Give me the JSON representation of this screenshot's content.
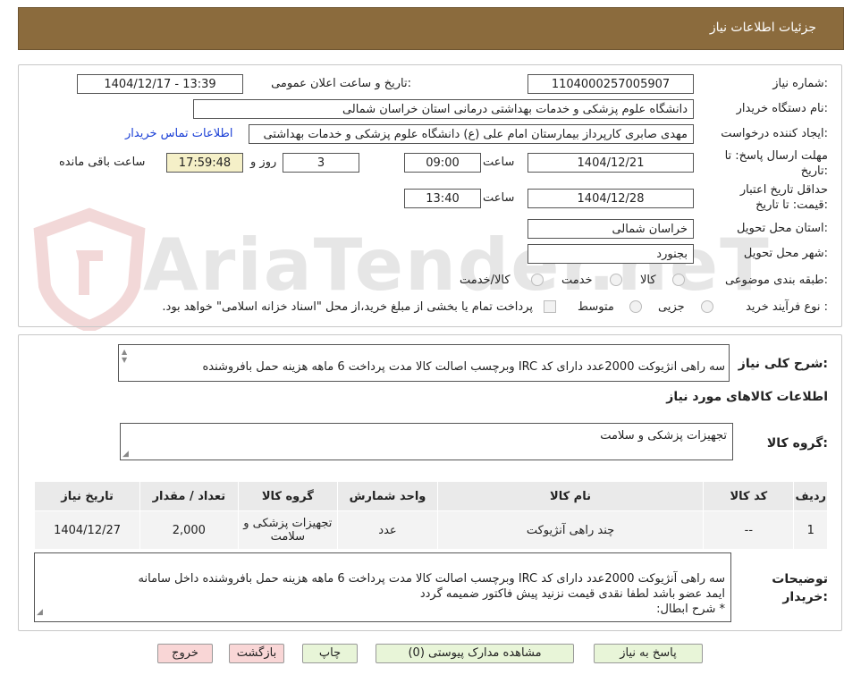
{
  "header": {
    "title": "جزئیات اطلاعات نیاز"
  },
  "watermark": "AriaTender.neT",
  "fields": {
    "need_number_label": "شماره نیاز:",
    "need_number": "1104000257005907",
    "announce_label": "تاریخ و ساعت اعلان عمومی:",
    "announce_value": "1404/12/17 - 13:39",
    "buyer_label": "نام دستگاه خریدار:",
    "buyer_value": "دانشگاه علوم پزشکی و خدمات بهداشتی درمانی استان خراسان شمالی",
    "creator_label": "ایجاد کننده درخواست:",
    "creator_value": "مهدی صابری کارپرداز بیمارستان امام علی (ع) دانشگاه علوم پزشکی و خدمات بهداشتی",
    "contact_link": "اطلاعات تماس خریدار",
    "deadline_label": "مهلت ارسال پاسخ: تا تاریخ:",
    "deadline_date": "1404/12/21",
    "time_label": "ساعت",
    "deadline_time": "09:00",
    "days_value": "3",
    "days_label": "روز و",
    "remaining_time": "17:59:48",
    "remaining_label": "ساعت باقی مانده",
    "validity_label": "حداقل تاریخ اعتبار قیمت: تا تاریخ:",
    "validity_date": "1404/12/28",
    "validity_time": "13:40",
    "province_label": "استان محل تحویل:",
    "province_value": "خراسان شمالی",
    "city_label": "شهر محل تحویل:",
    "city_value": "بجنورد",
    "category_label": "طبقه بندی موضوعی:",
    "category_options": [
      "کالا",
      "خدمت",
      "کالا/خدمت"
    ],
    "process_label": "نوع فرآیند خرید :",
    "process_options": [
      "جزیی",
      "متوسط"
    ],
    "payment_note": "پرداخت تمام یا بخشی از مبلغ خرید،از محل \"اسناد خزانه اسلامی\" خواهد بود."
  },
  "summary": {
    "label": "شرح کلی نیاز:",
    "text": "سه راهی آنژیوکت 2000عدد دارای کد IRC وبرچسب اصالت کالا مدت پرداخت 6 ماهه هزینه حمل بافروشنده"
  },
  "goods": {
    "section_title": "اطلاعات کالاهای مورد نیاز",
    "group_label": "گروه کالا:",
    "group_value": "تجهیزات پزشکی و سلامت",
    "columns": [
      "ردیف",
      "کد کالا",
      "نام کالا",
      "واحد شمارش",
      "گروه کالا",
      "تعداد / مقدار",
      "تاریخ نیاز"
    ],
    "rows": [
      {
        "row": "1",
        "code": "--",
        "name": "چند راهی آنژیوکت",
        "unit": "عدد",
        "group": "تجهیزات پزشکی و سلامت",
        "qty": "2,000",
        "date": "1404/12/27"
      }
    ]
  },
  "buyer_notes": {
    "label": "توضیحات خریدار:",
    "line1": "سه راهی آنژیوکت 2000عدد دارای کد IRC وبرچسب اصالت کالا مدت پرداخت 6 ماهه هزینه حمل بافروشنده داخل سامانه",
    "line2": "ایمد عضو باشد لطفا نقدی قیمت نزنید  پیش فاکتور ضمیمه گردد",
    "line3": "* شرح ابطال:"
  },
  "buttons": {
    "reply": "پاسخ به نیاز",
    "attachments": "مشاهده مدارک پیوستی (0)",
    "print": "چاپ",
    "back": "بازگشت",
    "exit": "خروج"
  },
  "colors": {
    "header_bg": "#8b6b3d",
    "link": "#1a3fd6",
    "remaining_bg": "#f5f0c8",
    "green_button": "#e8f5d8",
    "pink_button": "#f9d6d6"
  }
}
